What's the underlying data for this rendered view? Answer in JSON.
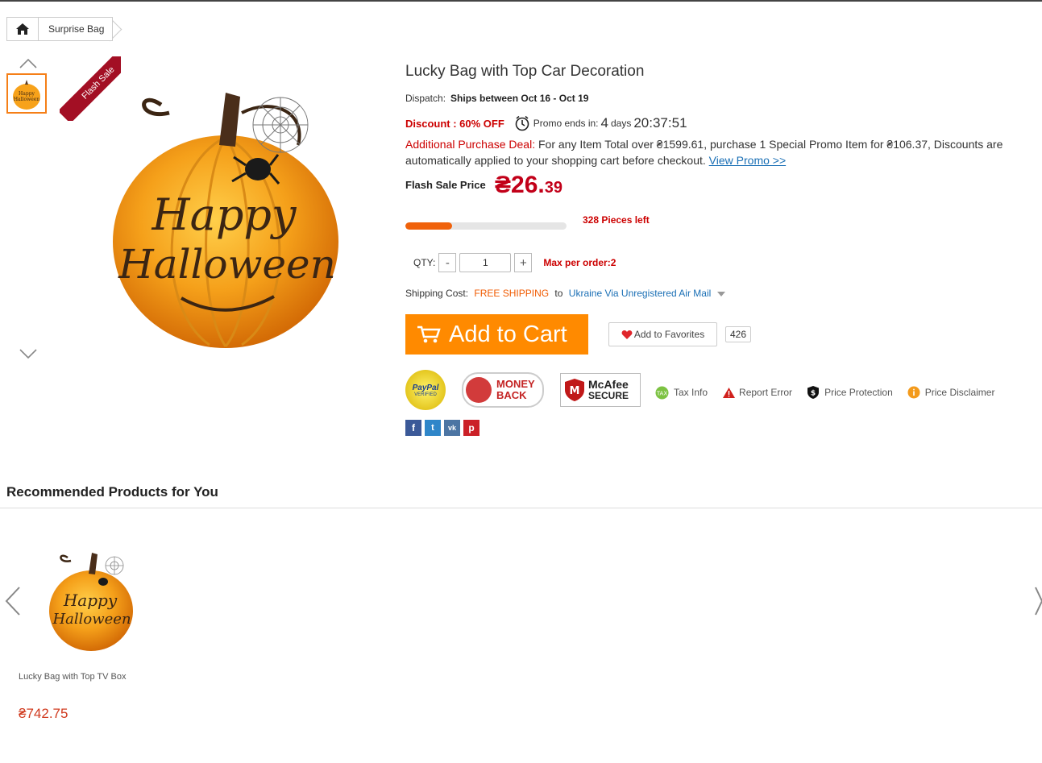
{
  "breadcrumb": {
    "home_icon": "home-icon",
    "current": "Surprise Bag"
  },
  "gallery": {
    "up_icon": "chevron-up-icon",
    "down_icon": "chevron-down-icon",
    "ribbon": "Flash Sale"
  },
  "product": {
    "title": "Lucky Bag with Top Car Decoration",
    "dispatch_label": "Dispatch:",
    "dispatch_value": "Ships between Oct 16 - Oct 19",
    "discount": "Discount : 60% OFF",
    "promo_label": "Promo ends in:",
    "countdown_days": "4",
    "days_label": "days",
    "countdown_time": "20:37:51",
    "additional_label": "Additional Purchase Deal:",
    "additional_text": " For any Item Total over ₴1599.61, purchase 1 Special Promo Item for ₴106.37, Discounts are automatically applied to your shopping cart before checkout. ",
    "view_promo": "View Promo >>",
    "flash_price_label": "Flash Sale Price",
    "price_main": "₴26.",
    "price_cents": "39",
    "stock_progress": 0.29,
    "pieces_left": "328 Pieces left",
    "qty_label": "QTY:",
    "qty_minus": "-",
    "qty_value": "1",
    "qty_plus": "+",
    "max_order": "Max per order:2",
    "shipping_label": "Shipping Cost:",
    "shipping_free": "FREE SHIPPING",
    "shipping_to": "to",
    "shipping_dest": "Ukraine Via Unregistered Air Mail",
    "add_to_cart": "Add to Cart",
    "add_to_favorites": "Add to Favorites",
    "favorites_count": "426"
  },
  "badges": {
    "paypal": "PayPal",
    "paypal_sub": "VERIFIED",
    "money_back": "MONEY BACK",
    "mcafee": "McAfee",
    "mcafee_sub": "SECURE"
  },
  "info_links": [
    "Tax Info",
    "Report Error",
    "Price Protection",
    "Price Disclaimer"
  ],
  "social": [
    "f",
    "t",
    "vk",
    "p"
  ],
  "colors": {
    "accent": "#ff8a00",
    "price": "#c20019",
    "link": "#1a6fb5",
    "sale_red": "#cc0000"
  },
  "recommended": {
    "title": "Recommended Products for You",
    "items": [
      {
        "name": "Lucky Bag with Top TV Box",
        "price": "₴742.75"
      }
    ]
  }
}
